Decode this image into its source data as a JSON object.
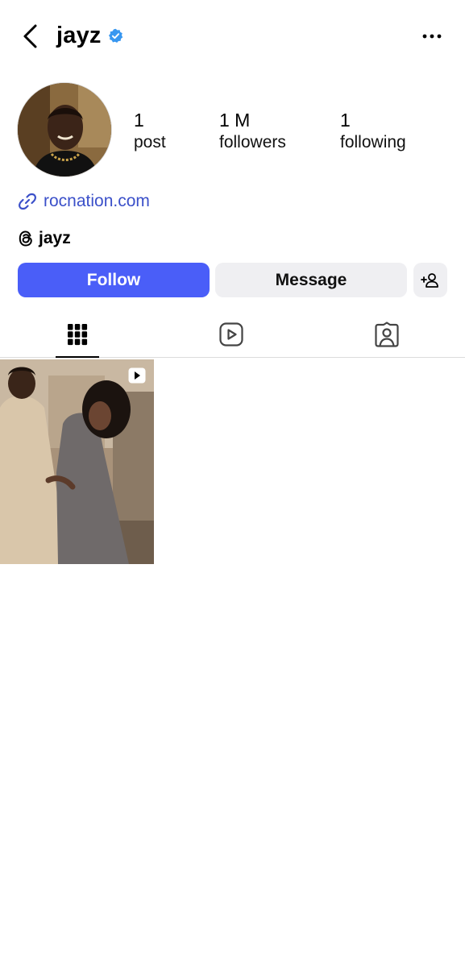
{
  "header": {
    "username": "jayz",
    "verified": true,
    "back_icon": "chevron-left-icon",
    "more_icon": "more-horizontal-icon"
  },
  "profile": {
    "avatar_alt": "jayz profile picture",
    "stats": {
      "posts": {
        "value": "1",
        "label": "post"
      },
      "followers": {
        "value": "1 M",
        "label": "followers"
      },
      "following": {
        "value": "1",
        "label": "following"
      }
    },
    "link": {
      "icon": "link-icon",
      "text": "rocnation.com"
    },
    "threads": {
      "icon": "threads-icon",
      "text": "jayz"
    }
  },
  "actions": {
    "follow_label": "Follow",
    "message_label": "Message",
    "add_user_icon": "add-user-icon"
  },
  "tabs": [
    {
      "name": "posts",
      "icon": "grid-icon",
      "active": true
    },
    {
      "name": "reels",
      "icon": "reels-icon",
      "active": false
    },
    {
      "name": "tagged",
      "icon": "tagged-icon",
      "active": false
    }
  ],
  "posts": [
    {
      "type": "reel",
      "badge_icon": "reel-badge-icon"
    }
  ],
  "colors": {
    "accent": "#4a5ef8",
    "link": "#3b50c9",
    "verified": "#3897f0",
    "secondary_button": "#efeff2"
  }
}
